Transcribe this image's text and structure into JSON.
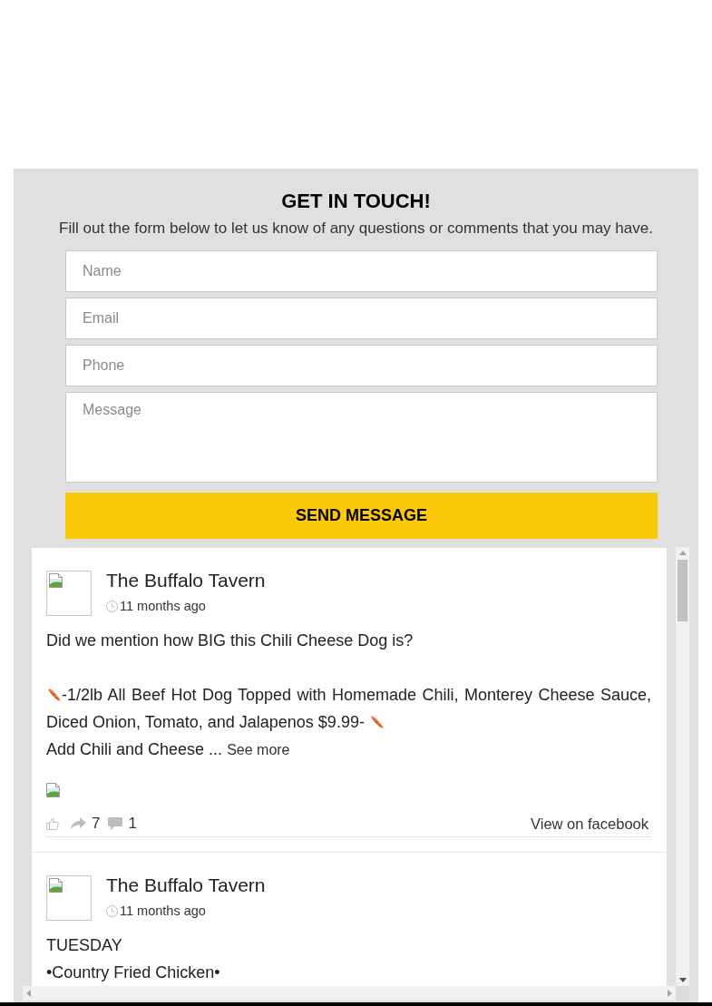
{
  "contact_form": {
    "title": "GET IN TOUCH!",
    "subtitle": "Fill out the form below to let us know of any questions or comments that you may have.",
    "fields": [
      {
        "kind": "input",
        "placeholder": "Name"
      },
      {
        "kind": "input",
        "placeholder": "Email"
      },
      {
        "kind": "input",
        "placeholder": "Phone"
      },
      {
        "kind": "textarea",
        "placeholder": "Message"
      }
    ],
    "submit": "SEND MESSAGE"
  },
  "feed": {
    "posts": [
      {
        "author": "The Buffalo Tavern",
        "time": "11 months ago",
        "body": [
          {
            "kind": "text",
            "text": "Did we mention how BIG this Chili Cheese Dog is?"
          },
          {
            "kind": "break"
          },
          {
            "kind": "hotdog_start",
            "text": "-1/2lb All Beef Hot Dog Topped with Homemade Chili, Monterey Cheese Sauce,"
          },
          {
            "kind": "hotdog_end",
            "text": "Diced Onion, Tomato, and Jalapenos $9.99-"
          },
          {
            "kind": "truncated",
            "text": "Add Chili and Cheese ...",
            "more": "See more"
          }
        ],
        "image": true,
        "stats": {
          "shares": "7",
          "comments": "1"
        },
        "link": "View on facebook"
      },
      {
        "author": "The Buffalo Tavern",
        "time": "11 months ago",
        "body": [
          {
            "kind": "text",
            "text": "TUESDAY"
          },
          {
            "kind": "text",
            "text": "•Country Fried Chicken•"
          }
        ]
      }
    ]
  }
}
